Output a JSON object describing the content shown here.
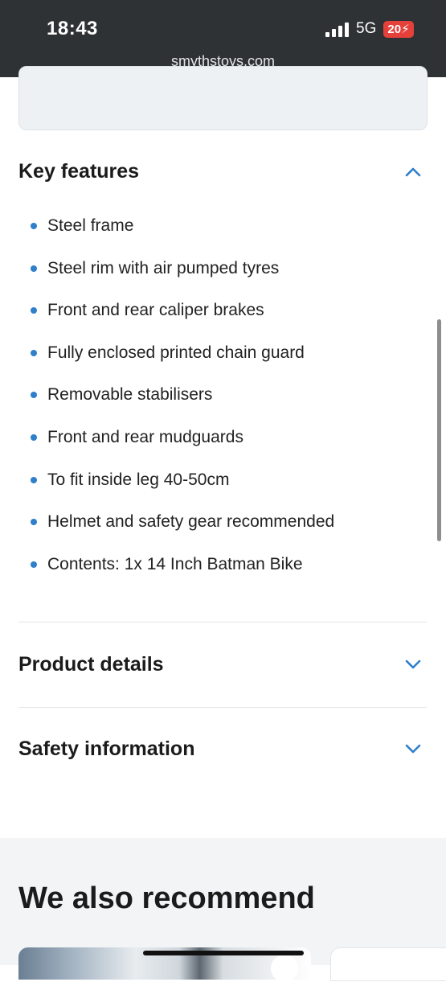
{
  "status_bar": {
    "time": "18:43",
    "network": "5G",
    "battery": "20",
    "url": "smythstoys.com"
  },
  "key_features": {
    "title": "Key features",
    "expanded": true,
    "items": [
      "Steel frame",
      "Steel rim with air pumped tyres",
      "Front and rear caliper brakes",
      "Fully enclosed printed chain guard",
      "Removable stabilisers",
      "Front and rear mudguards",
      "To fit inside leg 40-50cm",
      "Helmet and safety gear recommended",
      "Contents: 1x 14 Inch Batman Bike"
    ]
  },
  "product_details": {
    "title": "Product details",
    "expanded": false
  },
  "safety_information": {
    "title": "Safety information",
    "expanded": false
  },
  "recommend": {
    "title": "We also recommend"
  },
  "colors": {
    "status_bar_bg": "#2f3234",
    "accent_blue": "#2f7fcb",
    "battery_red": "#e5403a",
    "recommend_bg": "#f2f4f6"
  }
}
